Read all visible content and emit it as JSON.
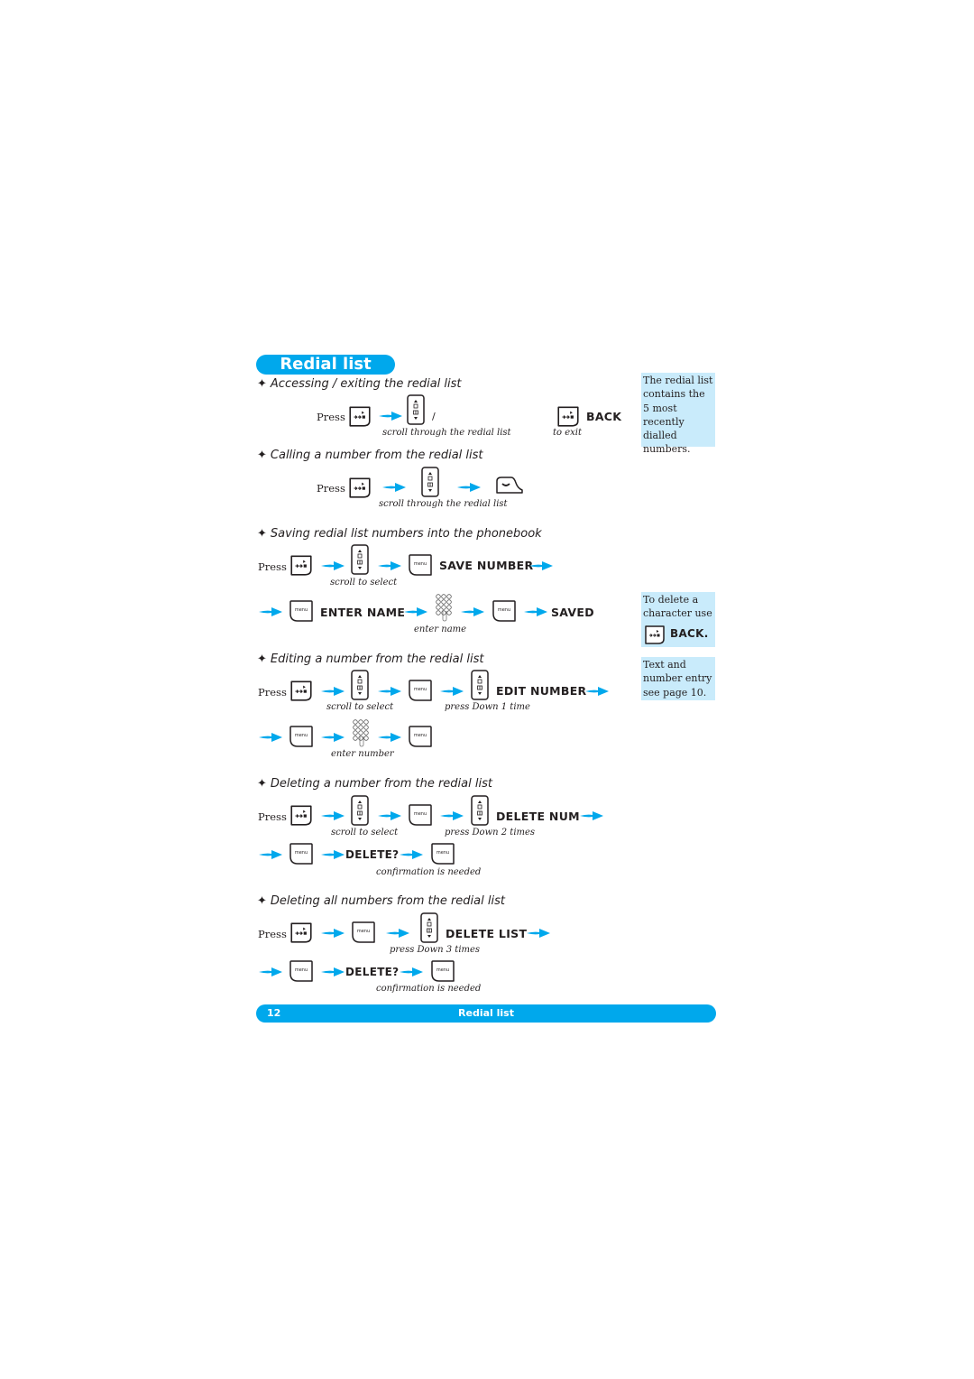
{
  "page": {
    "title": "Redial list",
    "footer": {
      "page_number": "12",
      "title": "Redial list"
    }
  },
  "colors": {
    "accent": "#00a8ec",
    "note_bg": "#c9ebfb",
    "text": "#231f20"
  },
  "icons": {
    "redial_key": "redial-key-icon",
    "nav_key": "navigation-updown-key-icon",
    "menu_key": "menu-key-icon",
    "call_key": "call-key-icon",
    "keypad": "keypad-icon",
    "arrow": "arrow-right-icon",
    "bullet": "star-bullet-icon"
  },
  "sections": [
    {
      "heading": "Accessing / exiting the redial list",
      "press": "Press",
      "slash": "/",
      "back_label": "BACK",
      "captions": [
        "scroll through the redial list",
        "to exit"
      ]
    },
    {
      "heading": "Calling a number from the redial list",
      "press": "Press",
      "captions": [
        "scroll through the redial list"
      ]
    },
    {
      "heading": "Saving redial list numbers into the phonebook",
      "press": "Press",
      "labels": [
        "SAVE NUMBER",
        "ENTER NAME",
        "SAVED"
      ],
      "captions": [
        "scroll to select",
        "enter name"
      ]
    },
    {
      "heading": "Editing a number from the redial list",
      "press": "Press",
      "labels": [
        "EDIT NUMBER"
      ],
      "captions": [
        "scroll to select",
        "press Down 1 time",
        "enter number"
      ]
    },
    {
      "heading": "Deleting a number from the redial list",
      "press": "Press",
      "labels": [
        "DELETE NUM",
        "DELETE?"
      ],
      "captions": [
        "scroll to select",
        "press Down 2 times",
        "confirmation is needed"
      ]
    },
    {
      "heading": "Deleting all numbers from the redial list",
      "press": "Press",
      "labels": [
        "DELETE LIST",
        "DELETE?"
      ],
      "captions": [
        "press Down 3 times",
        "confirmation is needed"
      ]
    }
  ],
  "sidebar_notes": [
    {
      "text": "The redial list contains the 5 most recently dialled numbers."
    },
    {
      "text_before": "To delete a character use",
      "key_label": "BACK."
    },
    {
      "text": "Text and number entry see page 10."
    }
  ],
  "menu_key_text": "menu",
  "bullet_glyph": "✦"
}
